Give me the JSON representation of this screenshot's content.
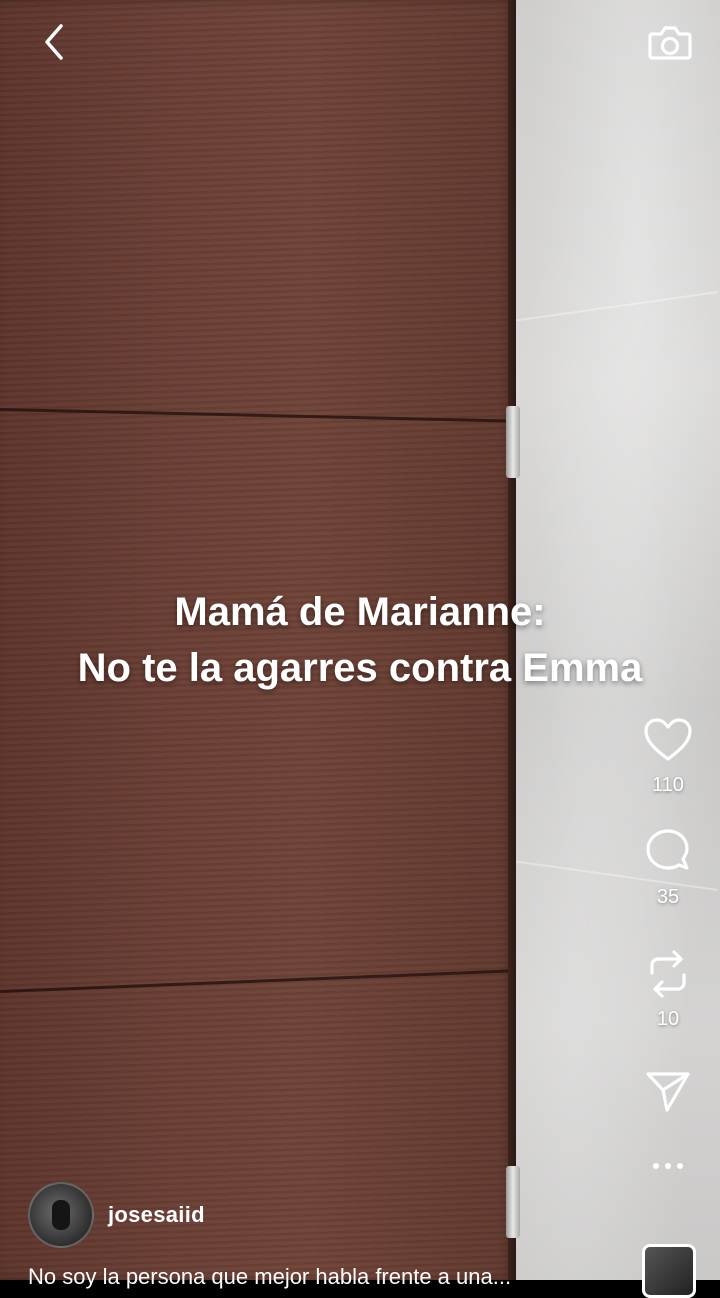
{
  "overlay": {
    "caption_line1": "Mamá de Marianne:",
    "caption_line2": "No te la agarres contra Emma"
  },
  "top_bar": {
    "back_icon": "chevron-left-icon",
    "camera_icon": "camera-icon"
  },
  "actions": {
    "like": {
      "icon": "heart-icon",
      "count": "110"
    },
    "comment": {
      "icon": "comment-bubble-icon",
      "count": "35"
    },
    "repost": {
      "icon": "repost-icon",
      "count": "10"
    },
    "share": {
      "icon": "send-icon"
    },
    "more": {
      "icon": "more-dots-icon"
    }
  },
  "author": {
    "username": "josesaiid",
    "description": "No soy la persona que mejor habla frente a una..."
  },
  "colors": {
    "text": "#ffffff",
    "door": "#6b4036",
    "wall": "#d3d2d1"
  }
}
